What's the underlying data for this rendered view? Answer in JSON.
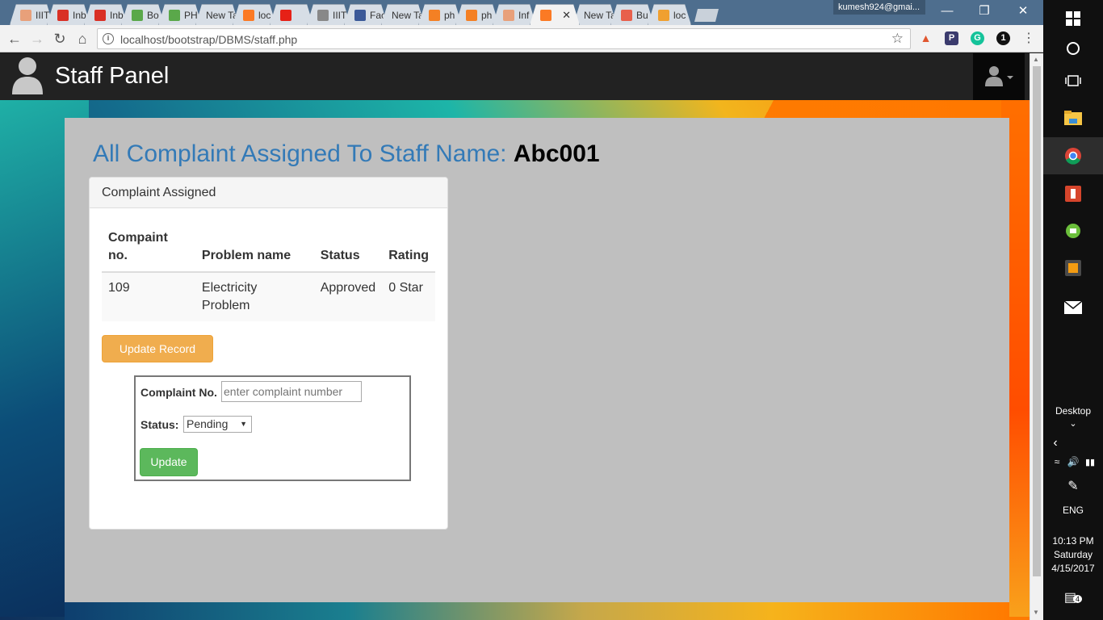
{
  "browser": {
    "tabs": [
      {
        "title": "IIIT",
        "icon": "bookpack-icon",
        "color": "#e8a07a"
      },
      {
        "title": "Inb",
        "icon": "gmail-icon",
        "color": "#d93025"
      },
      {
        "title": "Inb",
        "icon": "gmail-icon",
        "color": "#d93025"
      },
      {
        "title": "Bo",
        "icon": "wifi-icon",
        "color": "#5aa84a"
      },
      {
        "title": "PH",
        "icon": "wifi-icon",
        "color": "#5aa84a"
      },
      {
        "title": "New Ta",
        "icon": "",
        "color": ""
      },
      {
        "title": "loc",
        "icon": "xampp-icon",
        "color": "#fb7a24"
      },
      {
        "title": "",
        "icon": "youtube-icon",
        "color": "#e62117"
      },
      {
        "title": "IIIT",
        "icon": "document-icon",
        "color": "#888888"
      },
      {
        "title": "Fac",
        "icon": "facebook-icon",
        "color": "#3b5998"
      },
      {
        "title": "New Ta",
        "icon": "",
        "color": ""
      },
      {
        "title": "ph",
        "icon": "stackoverflow-icon",
        "color": "#f48024"
      },
      {
        "title": "ph",
        "icon": "stackoverflow-icon",
        "color": "#f48024"
      },
      {
        "title": "Inf",
        "icon": "bookpack-icon",
        "color": "#e8a07a"
      },
      {
        "title": "",
        "icon": "xampp-icon",
        "color": "#fb7a24",
        "active": true
      },
      {
        "title": "New Ta",
        "icon": "",
        "color": ""
      },
      {
        "title": "Bu",
        "icon": "plus-icon",
        "color": "#e8604c"
      },
      {
        "title": "loc",
        "icon": "pma-icon",
        "color": "#f0a030"
      }
    ],
    "profile": "kumesh924@gmai...",
    "url": "localhost/bootstrap/DBMS/staff.php"
  },
  "navbar": {
    "title": "Staff Panel"
  },
  "main": {
    "heading_prefix": "All Complaint Assigned To Staff Name: ",
    "staff_name": "Abc001",
    "panel_title": "Complaint Assigned",
    "table": {
      "headers": [
        "Compaint no.",
        "Problem name",
        "Status",
        "Rating"
      ],
      "rows": [
        [
          "109",
          "Electricity Problem",
          "Approved",
          "0 Star"
        ]
      ]
    },
    "update_record_label": "Update Record",
    "form": {
      "complaint_label": "Complaint No.",
      "complaint_placeholder": "enter complaint number",
      "status_label": "Status:",
      "status_value": "Pending",
      "submit_label": "Update"
    }
  },
  "taskbar": {
    "desktop_label": "Desktop",
    "language": "ENG",
    "time": "10:13 PM",
    "day": "Saturday",
    "date": "4/15/2017",
    "notification_count": "4"
  },
  "colors": {
    "heading": "#337ab7",
    "update_record_bg": "#f0ad4e",
    "update_btn_bg": "#5cb85c",
    "navbar_bg": "#222222"
  }
}
